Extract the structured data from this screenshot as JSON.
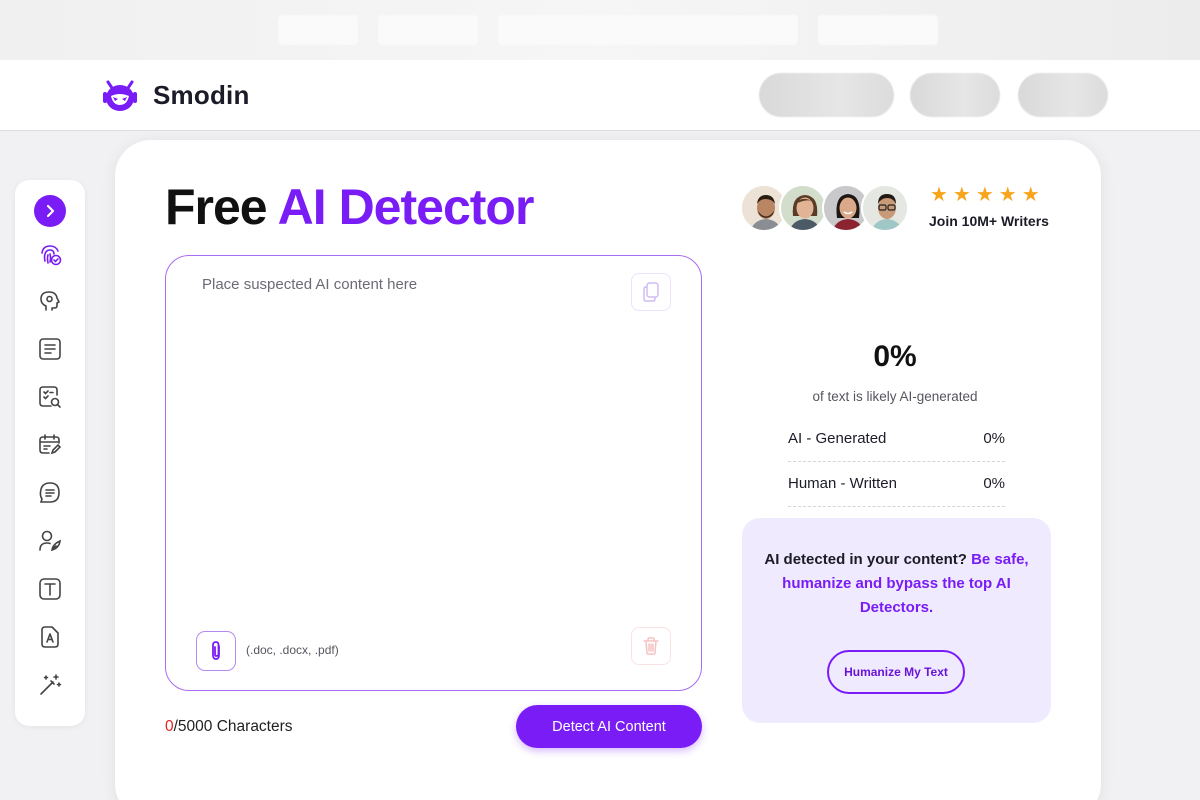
{
  "brand": {
    "name": "Smodin"
  },
  "hero": {
    "title_plain": "Free",
    "title_accent": "AI Detector",
    "stars": "★★★★★",
    "join_label": "Join 10M+ Writers"
  },
  "editor": {
    "placeholder": "Place suspected AI content here",
    "formats": "(.doc, .docx, .pdf)"
  },
  "counter": {
    "current": "0",
    "max_label": "/5000 Characters"
  },
  "detect_button": "Detect AI Content",
  "results": {
    "percentage": "0%",
    "subtitle": "of text is likely AI-generated",
    "rows": [
      {
        "label": "AI - Generated",
        "value": "0%"
      },
      {
        "label": "Human - Written",
        "value": "0%"
      }
    ]
  },
  "promo": {
    "lead": "AI detected in your content?",
    "highlight": "Be safe, humanize and bypass the top AI Detectors.",
    "button": "Humanize My Text"
  },
  "sidebar": {
    "items": [
      {
        "icon": "chevron-right-icon"
      },
      {
        "icon": "fingerprint-check-icon"
      },
      {
        "icon": "head-brain-icon"
      },
      {
        "icon": "document-lines-icon"
      },
      {
        "icon": "document-search-icon"
      },
      {
        "icon": "calendar-edit-icon"
      },
      {
        "icon": "chat-lines-icon"
      },
      {
        "icon": "user-feather-icon"
      },
      {
        "icon": "text-box-icon"
      },
      {
        "icon": "document-a-icon"
      },
      {
        "icon": "magic-wand-icon"
      }
    ]
  },
  "colors": {
    "accent": "#7a1cf5",
    "star": "#f8a51d",
    "counter_current": "#e02424",
    "promo_bg": "#efeafd"
  }
}
